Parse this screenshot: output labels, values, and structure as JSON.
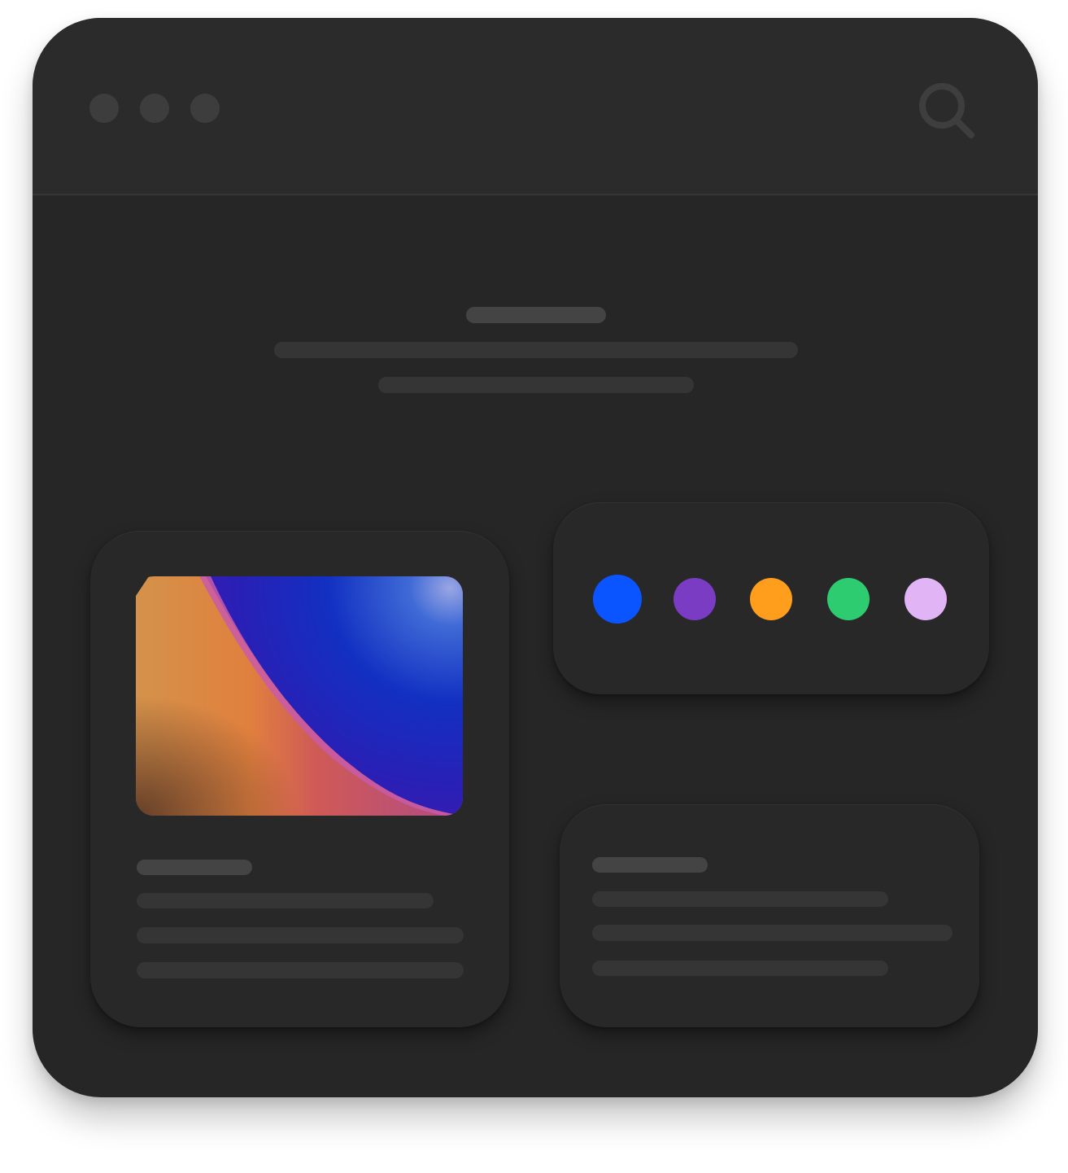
{
  "window": {
    "background": "#262626",
    "titlebar_background": "#2b2b2b"
  },
  "titlebar": {
    "traffic_lights": [
      "window-control",
      "window-control",
      "window-control"
    ],
    "search_icon": "search-icon"
  },
  "palette": {
    "swatches": [
      {
        "name": "blue",
        "color": "#0a55ff"
      },
      {
        "name": "purple",
        "color": "#7a3cc2"
      },
      {
        "name": "orange",
        "color": "#ff9d1c"
      },
      {
        "name": "green",
        "color": "#2ecc71"
      },
      {
        "name": "lavender",
        "color": "#e0b4f5"
      }
    ],
    "selected": "blue"
  },
  "feature_card": {
    "image": "gradient-artwork"
  }
}
